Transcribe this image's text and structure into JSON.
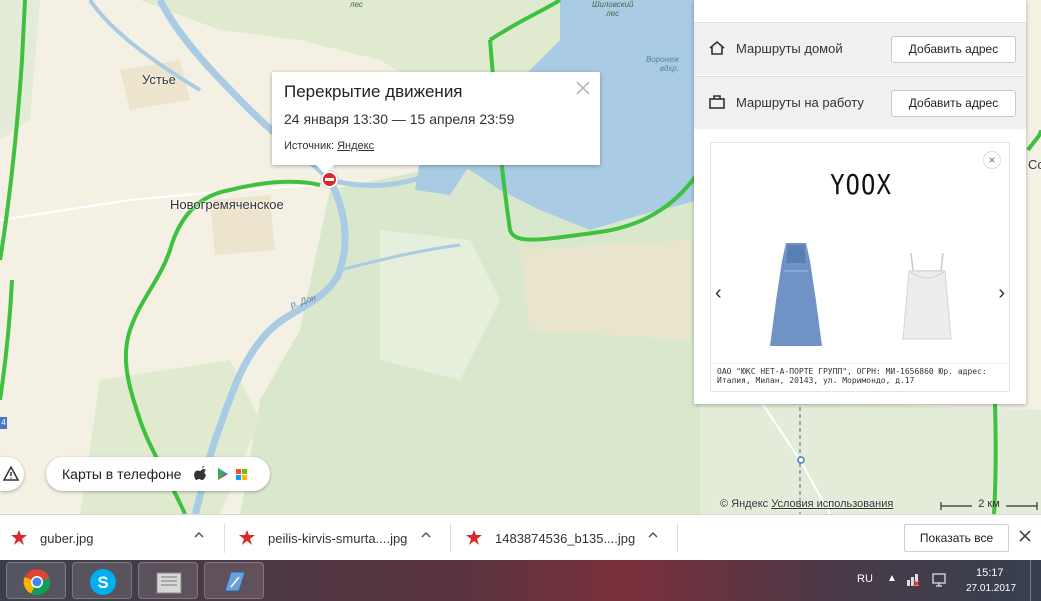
{
  "map": {
    "places": {
      "ustye": "Устье",
      "novogremyachenskoe": "Новогремяченское",
      "edge_right": "Со"
    },
    "water_labels": {
      "reservoir_line1": "Воронеж",
      "reservoir_line2": "вдхр."
    },
    "forest_labels": {
      "top_left": "лес",
      "top_right_line1": "Шиловский",
      "top_right_line2": "лес"
    },
    "river_label": "р. Дон",
    "road_sign": "4",
    "popup": {
      "title": "Перекрытие движения",
      "dates": "24 января 13:30 — 15 апреля 23:59",
      "source_label": "Источник:",
      "source_link": "Яндекс",
      "close_icon": "close-icon"
    },
    "phone_promo": "Карты в телефоне",
    "copyright": "© Яндекс",
    "terms_link": "Условия использования",
    "scale": "2 км"
  },
  "panel": {
    "routes_home_label": "Маршруты домой",
    "routes_work_label": "Маршруты на работу",
    "add_address_label": "Добавить адрес",
    "ad": {
      "brand": "YOOX",
      "legal": "ОАО \"ЮКС НЕТ-А-ПОРТЕ ГРУПП\", ОГРН: МИ-1656860 Юр. адрес: Италия, Милан, 20143, ул. Моримондо, д.17",
      "prev_arrow": "‹",
      "next_arrow": "›"
    }
  },
  "downloads": {
    "items": [
      {
        "name": "guber.jpg"
      },
      {
        "name": "peilis-kirvis-smurta....jpg"
      },
      {
        "name": "1483874536_b135....jpg"
      }
    ],
    "show_all": "Показать все"
  },
  "taskbar": {
    "lang": "RU",
    "time": "15:17",
    "date": "27.01.2017"
  },
  "colors": {
    "road_green": "#3ec13e",
    "water": "#a9cbe3",
    "forest": "#d9e8cd",
    "land": "#f4f0e4",
    "closure_red": "#d52b2b"
  }
}
